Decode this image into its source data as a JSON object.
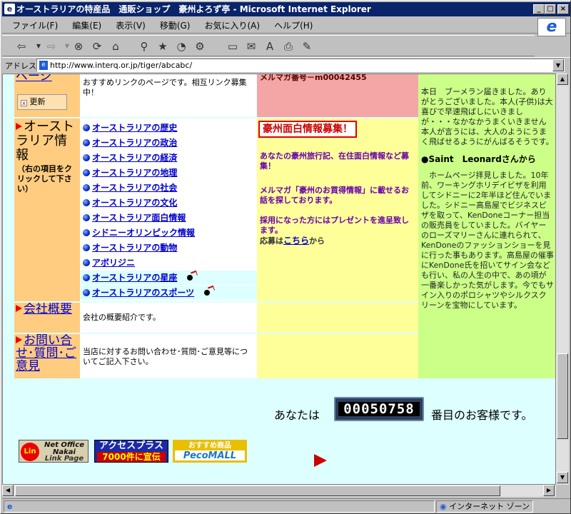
{
  "window": {
    "title": "オーストラリアの特産品　通販ショップ　豪州よろず亭 - Microsoft Internet Explorer",
    "btn_min": "_",
    "btn_max": "□",
    "btn_close": "×"
  },
  "menu": [
    "ファイル(F)",
    "編集(E)",
    "表示(V)",
    "移動(G)",
    "お気に入り(A)",
    "ヘルプ(H)"
  ],
  "address": {
    "label": "アドレス",
    "url": "http://www.interq.or.jp/tiger/abcabc/"
  },
  "page": {
    "top_link": "ページ",
    "top_desc": "おすすめリンクのページです。相互リンク募集中！",
    "update_label": "更新",
    "mailmag_no": "メルマガ番号－m00042455",
    "aus_title": "オーストラリア情報",
    "aus_note": "（右の項目をクリックして下さい）",
    "aus_items": [
      "オーストラリアの歴史",
      "オーストラリアの政治",
      "オーストラリアの経済",
      "オーストラリアの地理",
      "オーストラリアの社会",
      "オーストラリアの文化",
      "オーストラリア面白情報",
      "シドニーオリンピック情報",
      "オーストラリアの動物",
      "アボリジニ",
      "オーストラリアの星座",
      "オーストラリアのスポーツ"
    ],
    "recruit_title": "豪州面白情報募集！",
    "recruit_p1": "あなたの豪州旅行記、在住面白情報など募集！",
    "recruit_p2": "メルマガ「豪州のお買得情報」に載せるお話を探しております。",
    "recruit_p3": "採用になった方にはプレゼントを進呈致します。",
    "recruit_apply_prefix": "応募は",
    "recruit_apply_link": "こちら",
    "recruit_apply_suffix": "から",
    "news_p1": "本日　ブーメラン届きました。ありがとうございました。本人(子供)は大喜びで早速飛ばしにいきましが・・・なかなかうまくいきません　本人が言うには、大人のようにうまく飛ばせるようにがんばるそうです。",
    "news_from": "●Saint　Leonardさんから",
    "news_p2": "　ホームページ拝見しました。10年前、ワーキングホリデイビザを利用してシドニーに2年半ほど住んでいました。シドニー高島屋でビジネスビザを取って、KenDoneコーナー担当の販売員をしていました。バイヤーのローズマリーさんに連れられて、KenDoneのファッションショーを見に行った事もあります。高島屋の催事にKenDone氏を招いてサイン会なども行い、私の人生の中で、あの頃が一番楽しかった気がします。今でもサイン入りのポロシャツやシルクスクリーンを宝物にしています。",
    "company_link": "会社概要",
    "company_desc": "会社の概要紹介です。",
    "contact_link": "お問い合せ･質問･ご意見",
    "contact_desc": "当店に対するお問い合わせ･質問･ご意見等についてご記入下さい。",
    "counter_prefix": "あなたは",
    "counter_value": "00050758",
    "counter_suffix": "番目のお客様です。",
    "banner1_top": "Net Office Nakai",
    "banner1_bottom": "Link Page",
    "banner2_top": "アクセスプラス",
    "banner2_bottom": "7000件に宣伝",
    "banner3_top": "おすすめ商品",
    "banner3_bottom": "PecoMALL"
  },
  "status": {
    "zone": "インターネット ゾーン"
  }
}
